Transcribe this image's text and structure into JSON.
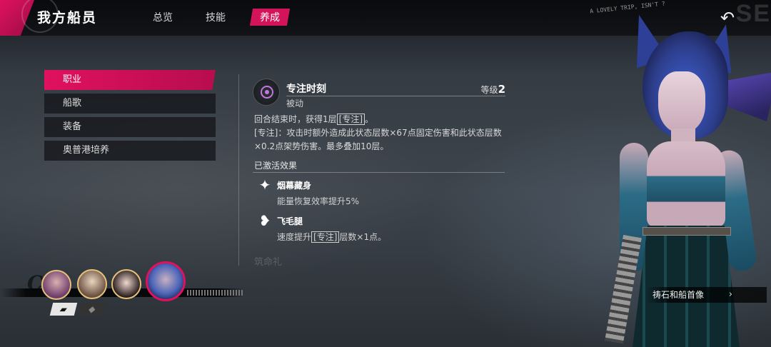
{
  "header": {
    "title": "我方船员",
    "tabs": [
      {
        "label": "总览",
        "active": false
      },
      {
        "label": "技能",
        "active": false
      },
      {
        "label": "养成",
        "active": true
      }
    ],
    "deco_text": "A LOVELY TRIP, ISN'T ?",
    "deco_big": "SE"
  },
  "menu": {
    "items": [
      {
        "label": "职业",
        "active": true
      },
      {
        "label": "船歌",
        "active": false
      },
      {
        "label": "装备",
        "active": false
      },
      {
        "label": "奥普港培养",
        "active": false
      }
    ]
  },
  "skill": {
    "icon": "target-icon",
    "name": "专注时刻",
    "level_label": "等级",
    "level_value": "2",
    "type": "被动",
    "desc_1a": "回合结束时，获得1层",
    "desc_1tag": "[专注]",
    "desc_1b": "。",
    "desc_2": "[专注]：攻击时额外造成此状态层数×67点固定伤害和此状态层数×0.2点架势伤害。最多叠加10层。"
  },
  "active_effects": {
    "title": "已激活效果",
    "items": [
      {
        "icon": "sparkle-icon",
        "name": "烟幕藏身",
        "desc": "能量恢复效率提升5%"
      },
      {
        "icon": "winged-heart-icon",
        "name": "飞毛腿",
        "desc_a": "速度提升",
        "desc_tag": "[专注]",
        "desc_b": "层数×1点。"
      }
    ],
    "faded_text": "筑命礼"
  },
  "characters": {
    "faction_label": "Co",
    "selected_index": 3,
    "faction_tabs": [
      "pirate-hat-icon",
      "beast-icon"
    ]
  },
  "portrait_button": {
    "label": "祷石和船首像"
  },
  "colors": {
    "accent": "#e0115f",
    "gold": "#e6c17a"
  }
}
